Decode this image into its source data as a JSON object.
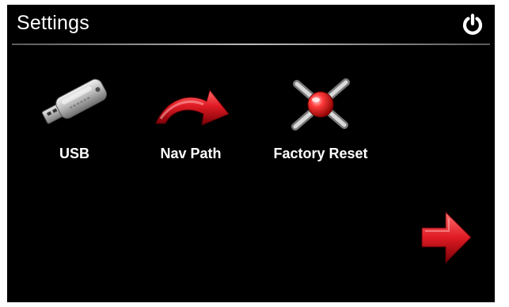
{
  "header": {
    "title": "Settings",
    "power_icon": "power-icon"
  },
  "tiles": [
    {
      "label": "USB",
      "icon": "usb-drive-icon"
    },
    {
      "label": "Nav Path",
      "icon": "curved-arrow-icon"
    },
    {
      "label": "Factory Reset",
      "icon": "factory-reset-icon"
    }
  ],
  "navigation": {
    "next_icon": "next-arrow-icon"
  },
  "colors": {
    "background": "#000000",
    "text": "#ffffff",
    "accent_red": "#e01b24"
  }
}
